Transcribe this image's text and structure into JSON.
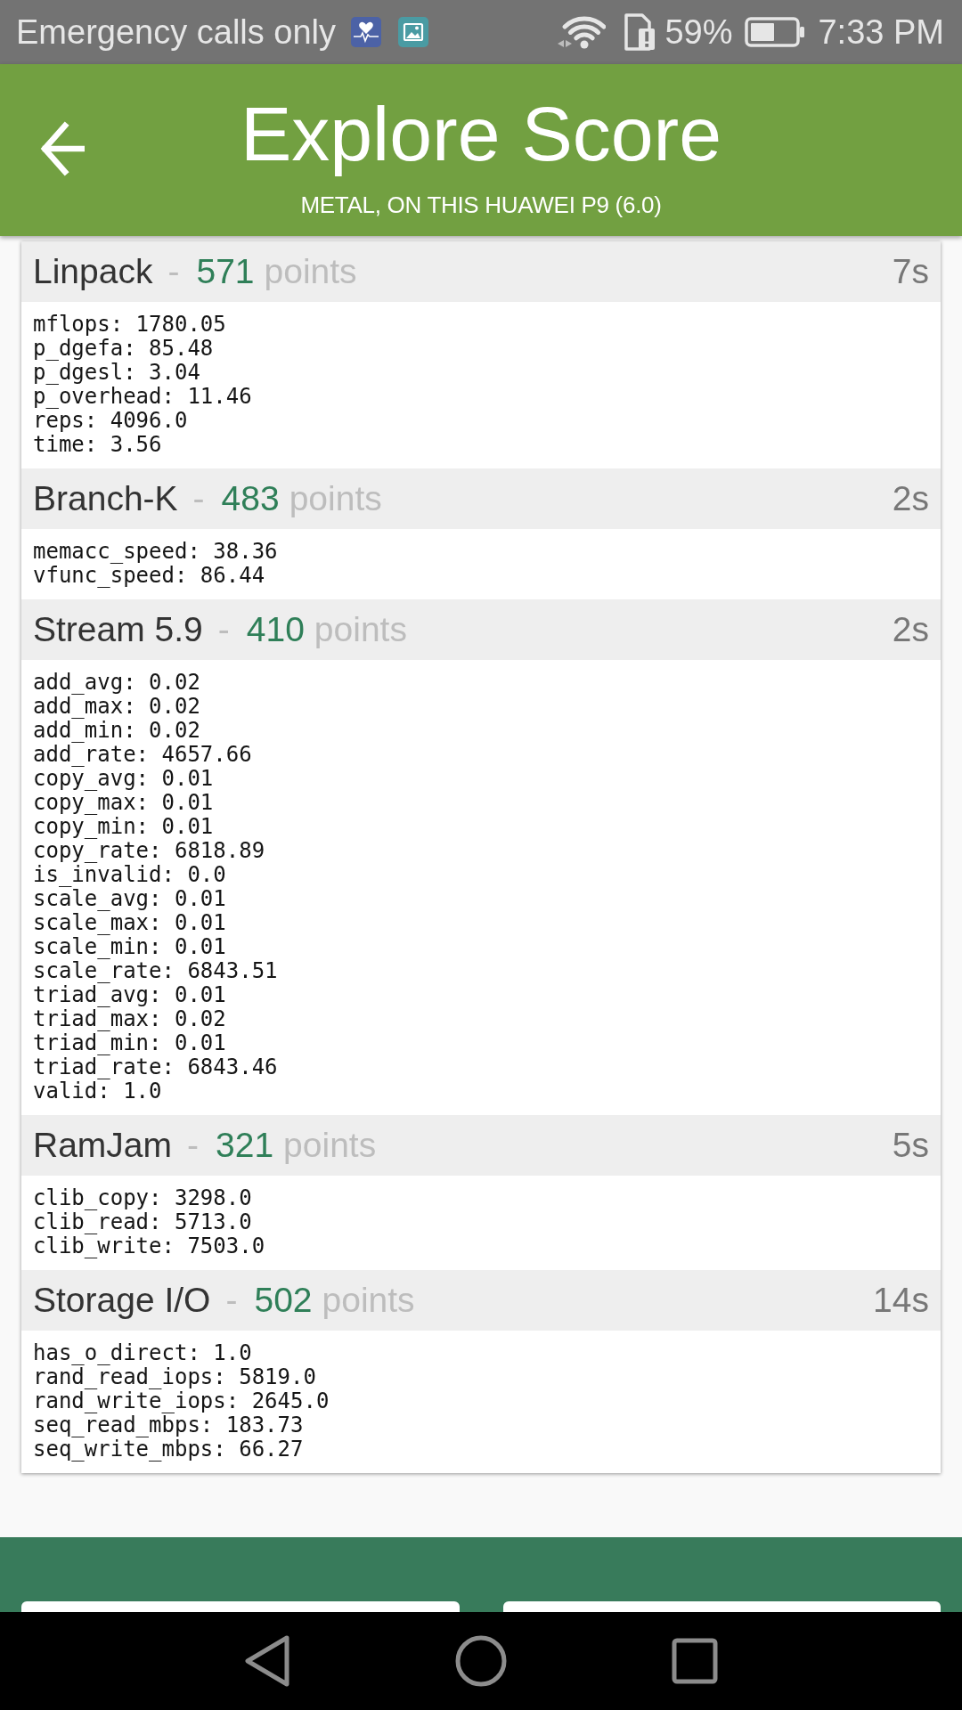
{
  "status_bar": {
    "carrier": "Emergency calls only",
    "battery": "59%",
    "time": "7:33 PM"
  },
  "app_bar": {
    "title": "Explore Score",
    "subtitle": "METAL, ON THIS HUAWEI P9 (6.0)"
  },
  "results": [
    {
      "name": "Linpack",
      "separator": "-",
      "score": "571",
      "unit": "points",
      "duration": "7s",
      "metrics": [
        "mflops: 1780.05",
        "p_dgefa: 85.48",
        "p_dgesl: 3.04",
        "p_overhead: 11.46",
        "reps: 4096.0",
        "time: 3.56"
      ]
    },
    {
      "name": "Branch-K",
      "separator": "-",
      "score": "483",
      "unit": "points",
      "duration": "2s",
      "metrics": [
        "memacc_speed: 38.36",
        "vfunc_speed: 86.44"
      ]
    },
    {
      "name": "Stream 5.9",
      "separator": "-",
      "score": "410",
      "unit": "points",
      "duration": "2s",
      "metrics": [
        "add_avg: 0.02",
        "add_max: 0.02",
        "add_min: 0.02",
        "add_rate: 4657.66",
        "copy_avg: 0.01",
        "copy_max: 0.01",
        "copy_min: 0.01",
        "copy_rate: 6818.89",
        "is_invalid: 0.0",
        "scale_avg: 0.01",
        "scale_max: 0.01",
        "scale_min: 0.01",
        "scale_rate: 6843.51",
        "triad_avg: 0.01",
        "triad_max: 0.02",
        "triad_min: 0.01",
        "triad_rate: 6843.46",
        "valid: 1.0"
      ]
    },
    {
      "name": "RamJam",
      "separator": "-",
      "score": "321",
      "unit": "points",
      "duration": "5s",
      "metrics": [
        "clib_copy: 3298.0",
        "clib_read: 5713.0",
        "clib_write: 7503.0"
      ]
    },
    {
      "name": "Storage I/O",
      "separator": "-",
      "score": "502",
      "unit": "points",
      "duration": "14s",
      "metrics": [
        "has_o_direct: 1.0",
        "rand_read_iops: 5819.0",
        "rand_write_iops: 2645.0",
        "seq_read_mbps: 183.73",
        "seq_write_mbps: 66.27"
      ]
    }
  ]
}
